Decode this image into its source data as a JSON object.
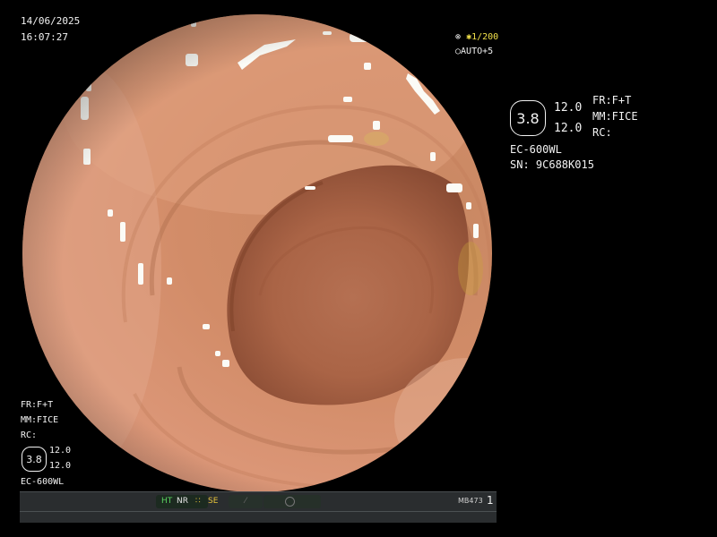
{
  "overlay": {
    "date": "14/06/2025",
    "time": "16:07:27",
    "zoom_prefix": "⊗",
    "zoom_star": "✱",
    "zoom_value": "1/200",
    "auto_icon": "○",
    "auto_value": "AUTO+5"
  },
  "right_panel": {
    "hex_value": "3.8",
    "value_1": "12.0",
    "value_2": "12.0",
    "fr": "FR:F+T",
    "mm": "MM:FICE",
    "rc": "RC:",
    "model": "EC-600WL",
    "serial": "SN: 9C688K015"
  },
  "left_panel": {
    "fr": "FR:F+T",
    "mm": "MM:FICE",
    "rc": "RC:",
    "hex_value": "3.8",
    "value_1": "12.0",
    "value_2": "12.0",
    "model": "EC-600WL"
  },
  "status_bar": {
    "ht": "HT",
    "nr": "NR",
    "se_icon": "∷",
    "se": "SE",
    "bolt": "⁄",
    "id": "MB473",
    "number": "1"
  }
}
